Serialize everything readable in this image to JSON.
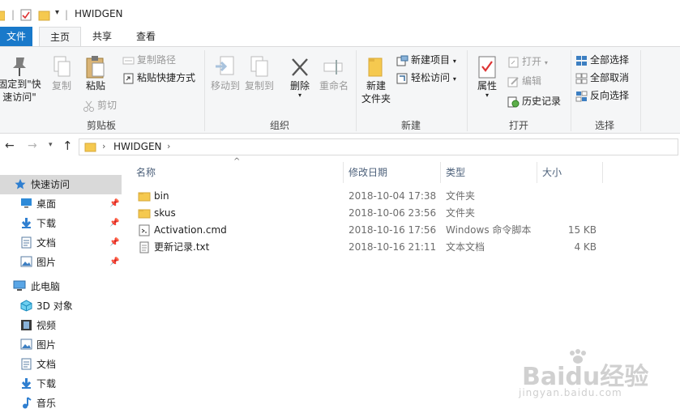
{
  "window": {
    "title": "HWIDGEN"
  },
  "ribbon_tabs": [
    "文件",
    "主页",
    "共享",
    "查看"
  ],
  "ribbon": {
    "clipboard": {
      "pin": "固定到\"快速访问\"",
      "pin_line1": "固定到\"快",
      "pin_line2": "速访问\"",
      "copy": "复制",
      "paste": "粘贴",
      "copy_path": "复制路径",
      "paste_shortcut": "粘贴快捷方式",
      "cut": "剪切",
      "group": "剪贴板"
    },
    "organize": {
      "move_to": "移动到",
      "copy_to": "复制到",
      "delete": "删除",
      "rename": "重命名",
      "group": "组织"
    },
    "new": {
      "new_folder_line1": "新建",
      "new_folder_line2": "文件夹",
      "new_item": "新建项目",
      "easy_access": "轻松访问",
      "group": "新建"
    },
    "open": {
      "properties": "属性",
      "open": "打开",
      "edit": "编辑",
      "history": "历史记录",
      "group": "打开"
    },
    "select": {
      "select_all": "全部选择",
      "select_none": "全部取消",
      "invert": "反向选择",
      "group": "选择"
    }
  },
  "address": {
    "path": "HWIDGEN"
  },
  "sidebar": {
    "quick_access": "快速访问",
    "qa_items": [
      "桌面",
      "下载",
      "文档",
      "图片"
    ],
    "this_pc": "此电脑",
    "pc_items": [
      "3D 对象",
      "视频",
      "图片",
      "文档",
      "下载",
      "音乐"
    ]
  },
  "columns": {
    "name": "名称",
    "date": "修改日期",
    "type": "类型",
    "size": "大小"
  },
  "files": [
    {
      "name": "bin",
      "date": "2018-10-04 17:38",
      "type": "文件夹",
      "size": "",
      "icon": "folder-icon"
    },
    {
      "name": "skus",
      "date": "2018-10-06 23:56",
      "type": "文件夹",
      "size": "",
      "icon": "folder-icon"
    },
    {
      "name": "Activation.cmd",
      "date": "2018-10-16 17:56",
      "type": "Windows 命令脚本",
      "size": "15 KB",
      "icon": "script-icon"
    },
    {
      "name": "更新记录.txt",
      "date": "2018-10-16 21:11",
      "type": "文本文档",
      "size": "4 KB",
      "icon": "text-file-icon"
    }
  ],
  "watermark": {
    "brand": "Baidu经验",
    "url": "jingyan.baidu.com"
  }
}
